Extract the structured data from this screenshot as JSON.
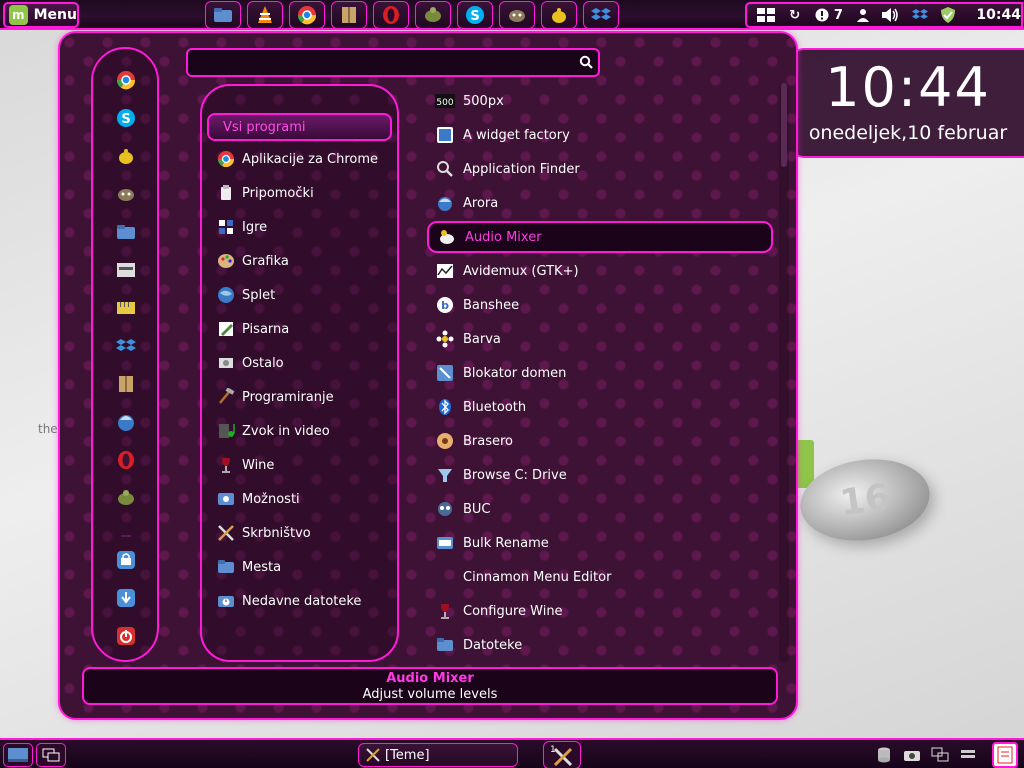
{
  "top_panel": {
    "menu_label": "Menu",
    "launchers": [
      "files-icon",
      "vlc-icon",
      "chrome-icon",
      "archive-icon",
      "opera-icon",
      "turtle-icon",
      "skype-icon",
      "gimp-icon",
      "tea-icon",
      "dropbox-icon"
    ],
    "tray": {
      "updates_count": "7",
      "clock": "10:44"
    }
  },
  "clock_widget": {
    "time": "10:44",
    "date": "onedeljek,10 februar"
  },
  "desktop": {
    "ghost_label": "the"
  },
  "menu": {
    "search": {
      "value": "",
      "placeholder": ""
    },
    "selected_category": "Vsi programi",
    "categories": [
      {
        "label": "Aplikacije za Chrome",
        "icon": "chrome-icon"
      },
      {
        "label": "Pripomočki",
        "icon": "accessories-icon"
      },
      {
        "label": "Igre",
        "icon": "games-icon"
      },
      {
        "label": "Grafika",
        "icon": "graphics-icon"
      },
      {
        "label": "Splet",
        "icon": "internet-icon"
      },
      {
        "label": "Pisarna",
        "icon": "office-icon"
      },
      {
        "label": "Ostalo",
        "icon": "other-icon"
      },
      {
        "label": "Programiranje",
        "icon": "programming-icon"
      },
      {
        "label": "Zvok in video",
        "icon": "multimedia-icon"
      },
      {
        "label": "Wine",
        "icon": "wine-icon"
      },
      {
        "label": "Možnosti",
        "icon": "preferences-icon"
      },
      {
        "label": "Skrbništvo",
        "icon": "administration-icon"
      },
      {
        "label": "Mesta",
        "icon": "places-icon"
      },
      {
        "label": "Nedavne datoteke",
        "icon": "recent-files-icon"
      }
    ],
    "applications": [
      {
        "label": "500px"
      },
      {
        "label": "A widget factory"
      },
      {
        "label": "Application Finder"
      },
      {
        "label": "Arora"
      },
      {
        "label": "Audio Mixer"
      },
      {
        "label": "Avidemux (GTK+)"
      },
      {
        "label": "Banshee"
      },
      {
        "label": "Barva"
      },
      {
        "label": "Blokator domen"
      },
      {
        "label": "Bluetooth"
      },
      {
        "label": "Brasero"
      },
      {
        "label": "Browse C: Drive"
      },
      {
        "label": "BUC"
      },
      {
        "label": "Bulk Rename"
      },
      {
        "label": "Cinnamon Menu Editor"
      },
      {
        "label": "Configure Wine"
      },
      {
        "label": "Datoteke"
      }
    ],
    "selected_app_index": 4,
    "description": {
      "title": "Audio Mixer",
      "subtitle": "Adjust volume levels"
    }
  },
  "bottom_panel": {
    "task_label": "[Teme]"
  },
  "colors": {
    "accent": "#ff1ad9",
    "panel_bg": "#2a0c28",
    "menu_bg": "#3d1234",
    "selected_text": "#ff3ae4"
  }
}
